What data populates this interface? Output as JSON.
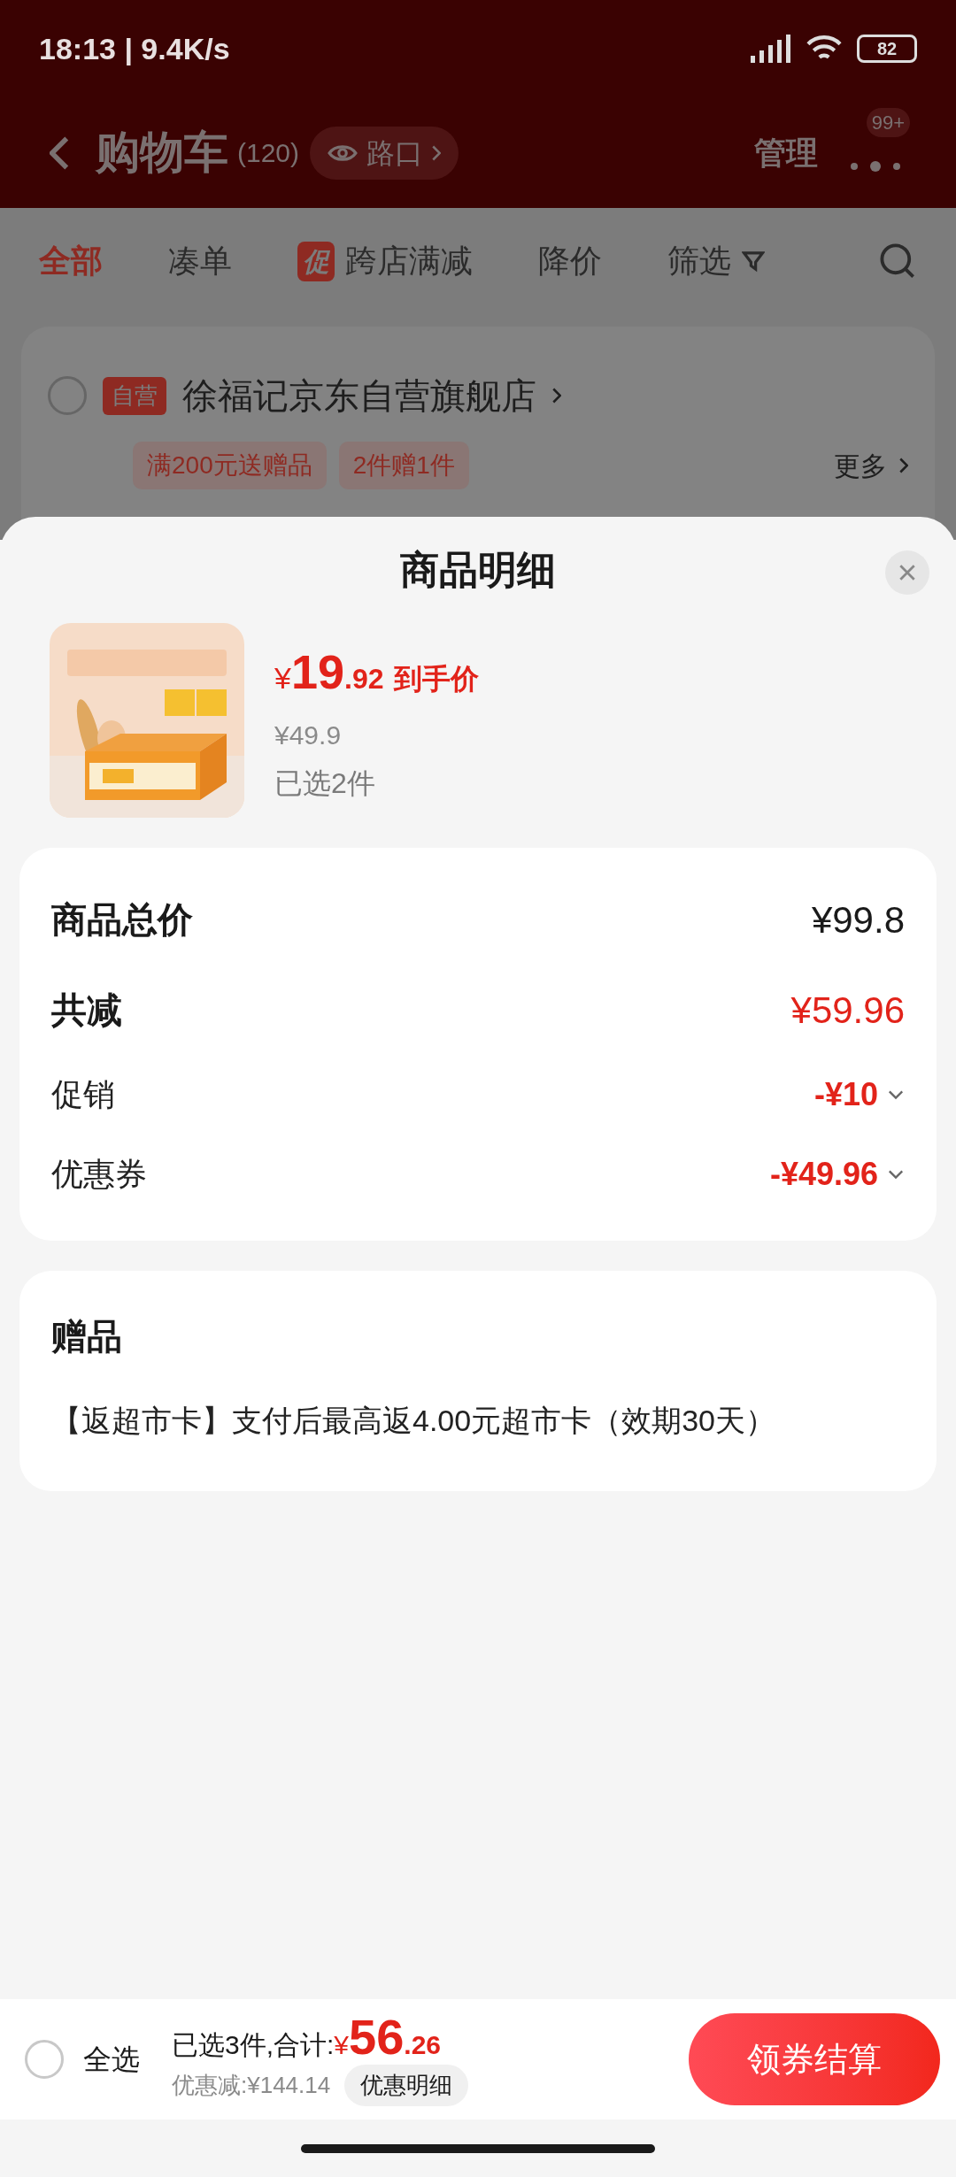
{
  "status_bar": {
    "time": "18:13 | 9.4K/s",
    "battery": "82"
  },
  "header": {
    "title": "购物车",
    "count": "(120)",
    "location": "路口",
    "manage": "管理",
    "badge": "99+"
  },
  "tabs": [
    {
      "kind": "plain",
      "label": "全部",
      "selected": true
    },
    {
      "kind": "plain",
      "label": "凑单",
      "selected": false
    },
    {
      "kind": "promo",
      "tag": "促",
      "label": "跨店满减",
      "selected": false
    },
    {
      "kind": "plain",
      "label": "降价",
      "selected": false
    },
    {
      "kind": "filter",
      "label": "筛选",
      "selected": false
    }
  ],
  "store": {
    "checked": false,
    "tag": "自营",
    "name": "徐福记京东自营旗舰店",
    "promos": [
      "满200元送赠品",
      "2件赠1件"
    ],
    "more": "更多"
  },
  "sheet": {
    "title": "商品明细",
    "product": {
      "price_symbol": "¥",
      "price_int": "19",
      "price_dec": ".92",
      "price_label": "到手价",
      "original_price": "¥49.9",
      "selected_count": "已选2件"
    },
    "summary": [
      {
        "kind": "total",
        "label": "商品总价",
        "value": "¥99.8",
        "highlight": false
      },
      {
        "kind": "total",
        "label": "共减",
        "value": "¥59.96",
        "highlight": true
      },
      {
        "kind": "detail",
        "label": "促销",
        "value": "-¥10",
        "highlight": true
      },
      {
        "kind": "detail",
        "label": "优惠券",
        "value": "-¥49.96",
        "highlight": true
      }
    ],
    "gifts": {
      "title": "赠品",
      "items": [
        "【返超市卡】支付后最高返4.00元超市卡（效期30天）"
      ]
    }
  },
  "bottom_bar": {
    "select_all": {
      "label": "全选",
      "checked": false
    },
    "summary": "已选3件,合计:",
    "price_symbol": "¥",
    "price_int": "56",
    "price_dec": ".26",
    "discount": "优惠减:¥144.14",
    "details_button": "优惠明细",
    "checkout": "领券结算"
  }
}
